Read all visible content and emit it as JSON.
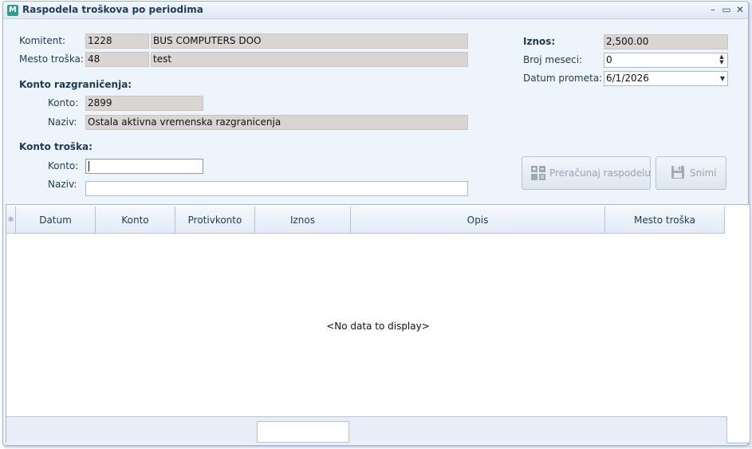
{
  "window": {
    "title": "Raspodela troškova po periodima",
    "icon_letter": "M"
  },
  "titlebar_controls": {
    "minimize": "–",
    "maximize": "▭",
    "close": "✕"
  },
  "komitent": {
    "label": "Komitent:",
    "code": "1228",
    "name": "BUS COMPUTERS DOO"
  },
  "mesto_troska": {
    "label": "Mesto troška:",
    "code": "48",
    "name": "test"
  },
  "konto_razgranicenja": {
    "heading": "Konto razgraničenja:",
    "konto_label": "Konto:",
    "konto_value": "2899",
    "naziv_label": "Naziv:",
    "naziv_value": "Ostala aktivna vremenska  razgranicenja"
  },
  "konto_troska": {
    "heading": "Konto troška:",
    "konto_label": "Konto:",
    "konto_value": "",
    "naziv_label": "Naziv:",
    "naziv_value": ""
  },
  "iznos": {
    "label": "Iznos:",
    "value": "2,500.00"
  },
  "broj_meseci": {
    "label": "Broj meseci:",
    "value": "0"
  },
  "datum_prometa": {
    "label": "Datum prometa:",
    "value": "6/1/2026"
  },
  "buttons": {
    "preracunaj": "Preračunaj raspodelu",
    "snimi": "Snimi"
  },
  "grid": {
    "row_indicator": "✻",
    "columns": [
      "Datum",
      "Konto",
      "Protivkonto",
      "Iznos",
      "Opis",
      "Mesto troška"
    ],
    "empty_text": "<No data to display>"
  }
}
